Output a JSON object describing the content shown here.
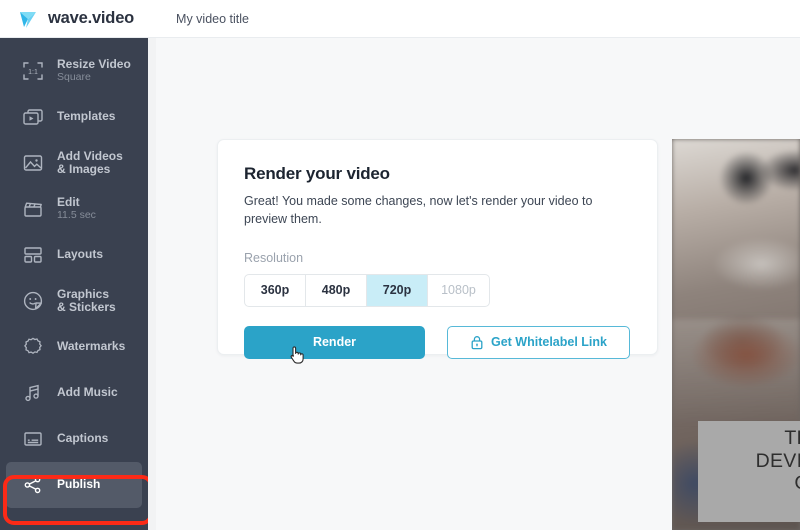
{
  "header": {
    "logo_icon": "wave-play-logo-icon",
    "logo_text": "wave.video",
    "document_title": "My video title"
  },
  "sidebar": {
    "background_color": "#3a4150",
    "items": [
      {
        "icon": "resize-frame-icon",
        "label": "Resize Video",
        "sub": "Square",
        "selected": false
      },
      {
        "icon": "templates-icon",
        "label": "Templates",
        "sub": "",
        "selected": false
      },
      {
        "icon": "image-icon",
        "label": "Add Videos\n& Images",
        "sub": "",
        "selected": false
      },
      {
        "icon": "clapperboard-icon",
        "label": "Edit",
        "sub": "11.5 sec",
        "selected": false
      },
      {
        "icon": "layouts-icon",
        "label": "Layouts",
        "sub": "",
        "selected": false
      },
      {
        "icon": "sticker-smiley-icon",
        "label": "Graphics\n& Stickers",
        "sub": "",
        "selected": false
      },
      {
        "icon": "watermark-badge-icon",
        "label": "Watermarks",
        "sub": "",
        "selected": false
      },
      {
        "icon": "music-note-icon",
        "label": "Add Music",
        "sub": "",
        "selected": false
      },
      {
        "icon": "captions-icon",
        "label": "Captions",
        "sub": "",
        "selected": false
      },
      {
        "icon": "share-nodes-icon",
        "label": "Publish",
        "sub": "",
        "selected": true
      }
    ],
    "annotation": {
      "shape": "rectangle",
      "color": "#fc2a17",
      "target": "Publish"
    }
  },
  "card": {
    "title": "Render your video",
    "description": "Great! You made some changes, now let's render your video to preview them.",
    "resolution_label": "Resolution",
    "resolution_options": [
      {
        "label": "360p",
        "state": "enabled"
      },
      {
        "label": "480p",
        "state": "enabled"
      },
      {
        "label": "720p",
        "state": "selected"
      },
      {
        "label": "1080p",
        "state": "disabled"
      }
    ],
    "selected_resolution": "720p",
    "render_button": "Render",
    "whitelabel_button": "Get Whitelabel Link",
    "whitelabel_icon": "lock-icon",
    "accent_color": "#2ba3c8",
    "selected_chip_color": "#c9edf7"
  },
  "preview": {
    "caption_lines": [
      "THIS",
      "DEVICE",
      "GUI"
    ],
    "caption_bg_color": "#a9a9a9"
  },
  "cursor": {
    "type": "pointing-hand-cursor"
  }
}
